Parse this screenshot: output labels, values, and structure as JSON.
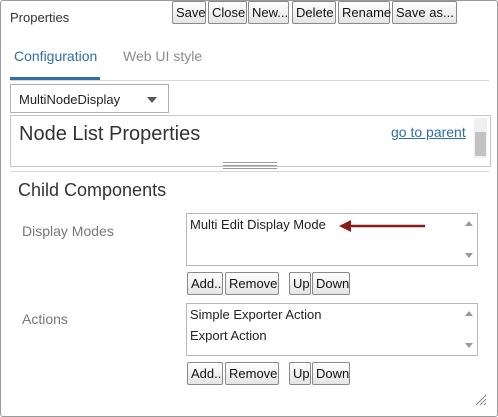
{
  "window": {
    "title": "Properties"
  },
  "tabs": [
    {
      "label": "Configuration",
      "active": true
    },
    {
      "label": "Web UI style",
      "active": false
    }
  ],
  "toolbar": {
    "dropdown_value": "MultiNodeDisplay",
    "save": "Save",
    "close": "Close",
    "new": "New...",
    "delete": "Delete",
    "rename": "Rename",
    "save_as": "Save as..."
  },
  "props": {
    "title": "Node List Properties",
    "go_to_parent": "go to parent"
  },
  "child": {
    "title": "Child Components",
    "display_modes": {
      "label": "Display Modes",
      "items": [
        "Multi Edit Display Mode"
      ]
    },
    "actions": {
      "label": "Actions",
      "items": [
        "Simple Exporter Action",
        "Export Action"
      ]
    },
    "buttons": {
      "add": "Add..",
      "remove": "Remove",
      "up": "Up",
      "down": "Down"
    }
  },
  "colors": {
    "accent": "#2f6fa7",
    "annotation_arrow": "#8b1a1a"
  }
}
